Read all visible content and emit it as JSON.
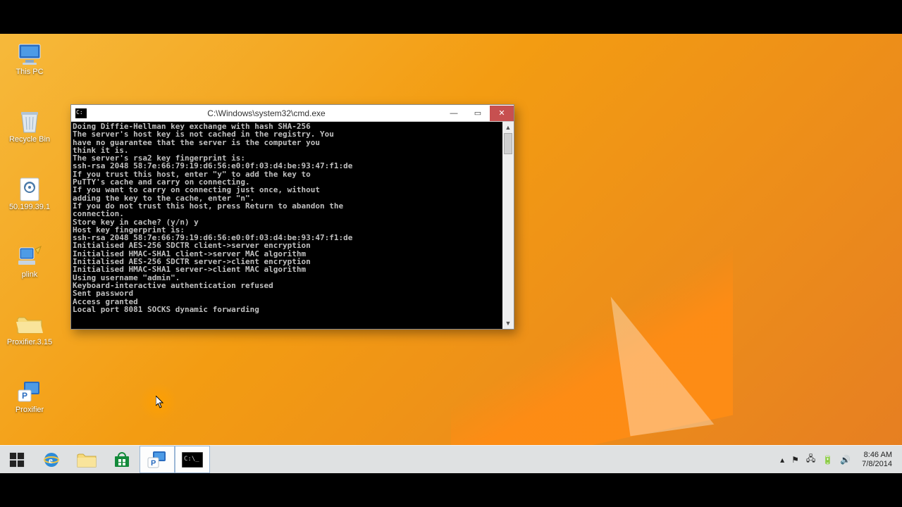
{
  "desktop": {
    "icons": [
      {
        "id": "this-pc",
        "label": "This PC"
      },
      {
        "id": "recycle-bin",
        "label": "Recycle Bin"
      },
      {
        "id": "rdp-shortcut",
        "label": "50.199.39.1"
      },
      {
        "id": "plink",
        "label": "plink"
      },
      {
        "id": "proxifier-folder",
        "label": "Proxifier.3.15"
      },
      {
        "id": "proxifier",
        "label": "Proxifier"
      }
    ]
  },
  "cmd": {
    "title": "C:\\Windows\\system32\\cmd.exe",
    "minimize": "—",
    "maximize": "▭",
    "close": "✕",
    "scroll_up": "▲",
    "scroll_down": "▼",
    "lines": [
      "Doing Diffie-Hellman key exchange with hash SHA-256",
      "The server's host key is not cached in the registry. You",
      "have no guarantee that the server is the computer you",
      "think it is.",
      "The server's rsa2 key fingerprint is:",
      "ssh-rsa 2048 58:7e:66:79:19:d6:56:e0:0f:03:d4:be:93:47:f1:de",
      "If you trust this host, enter \"y\" to add the key to",
      "PuTTY's cache and carry on connecting.",
      "If you want to carry on connecting just once, without",
      "adding the key to the cache, enter \"n\".",
      "If you do not trust this host, press Return to abandon the",
      "connection.",
      "Store key in cache? (y/n) y",
      "Host key fingerprint is:",
      "ssh-rsa 2048 58:7e:66:79:19:d6:56:e0:0f:03:d4:be:93:47:f1:de",
      "Initialised AES-256 SDCTR client->server encryption",
      "Initialised HMAC-SHA1 client->server MAC algorithm",
      "Initialised AES-256 SDCTR server->client encryption",
      "Initialised HMAC-SHA1 server->client MAC algorithm",
      "Using username \"admin\".",
      "Keyboard-interactive authentication refused",
      "Sent password",
      "Access granted",
      "Local port 8081 SOCKS dynamic forwarding"
    ]
  },
  "taskbar": {
    "apps": [
      {
        "id": "start",
        "name": "Start"
      },
      {
        "id": "ie",
        "name": "Internet Explorer"
      },
      {
        "id": "explorer",
        "name": "File Explorer"
      },
      {
        "id": "store",
        "name": "Store"
      },
      {
        "id": "proxifier",
        "name": "Proxifier"
      },
      {
        "id": "cmd",
        "name": "Command Prompt"
      }
    ],
    "tray": {
      "show_hidden": "▴",
      "flag": "⚑",
      "network": "🖧",
      "power": "🔋",
      "volume": "🔊"
    },
    "clock": {
      "time": "8:46 AM",
      "date": "7/8/2014"
    }
  }
}
